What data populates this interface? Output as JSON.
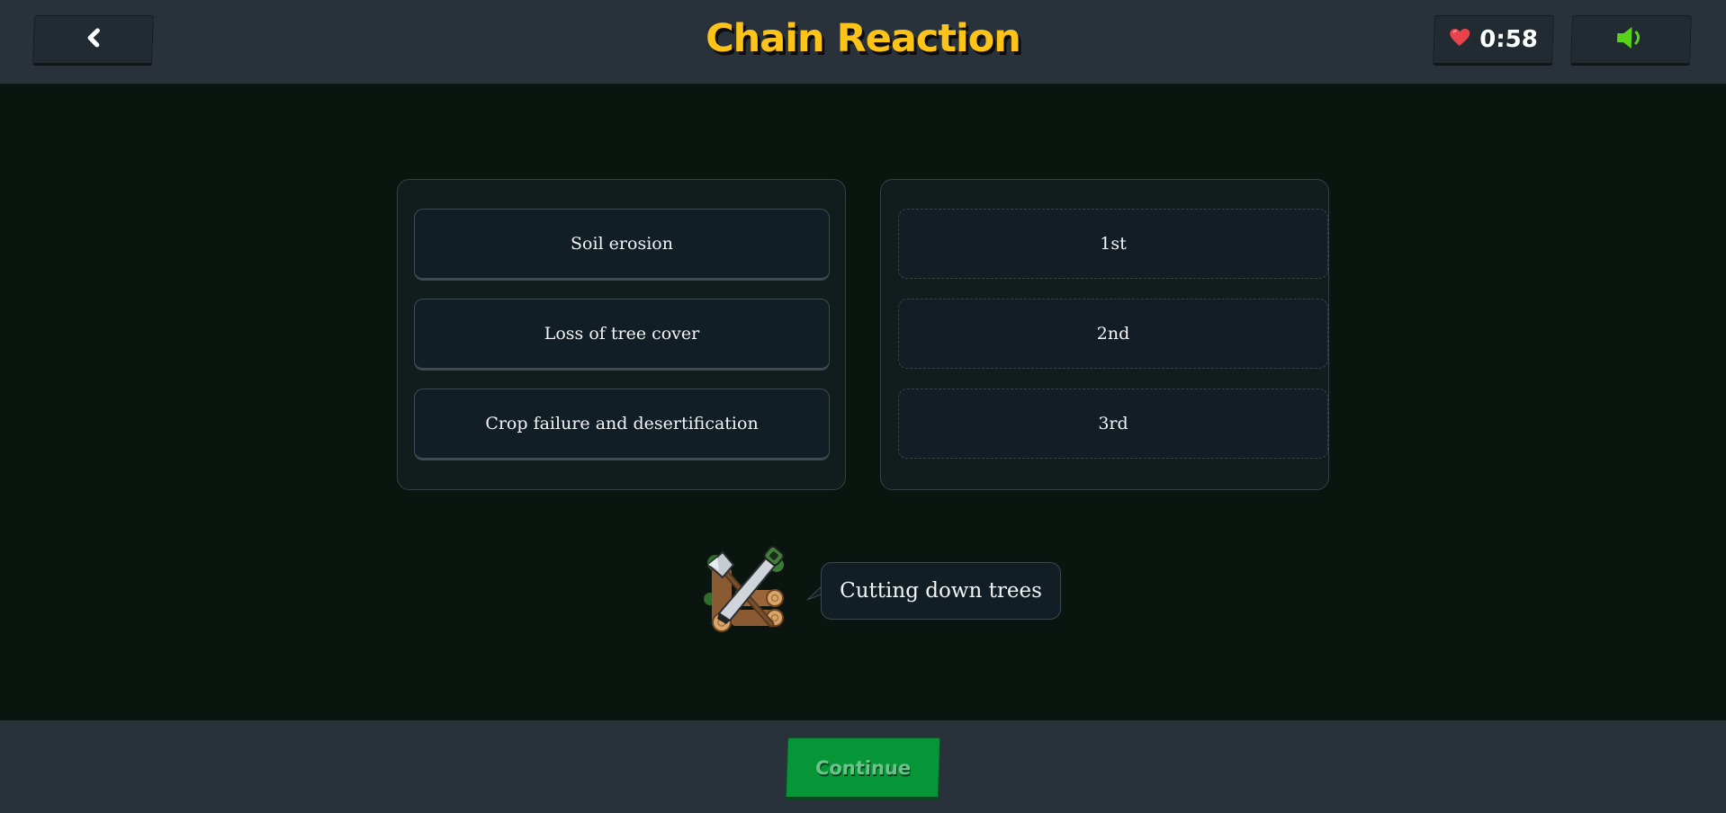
{
  "header": {
    "title": "Chain Reaction",
    "timer": "0:58",
    "back_icon": "chevron-left-icon",
    "heart_icon": "heart-icon",
    "sound_icon": "speaker-icon"
  },
  "options": [
    {
      "label": "Soil erosion"
    },
    {
      "label": "Loss of tree cover"
    },
    {
      "label": "Crop failure and desertification"
    }
  ],
  "slots": [
    {
      "label": "1st"
    },
    {
      "label": "2nd"
    },
    {
      "label": "3rd"
    }
  ],
  "prompt": {
    "text": "Cutting down trees",
    "icon": "axe-and-saw-icon"
  },
  "footer": {
    "continue_label": "Continue"
  },
  "colors": {
    "title": "#fcc419",
    "heart": "#e8424a",
    "sound": "#5bd21a",
    "continue": "#069638"
  }
}
